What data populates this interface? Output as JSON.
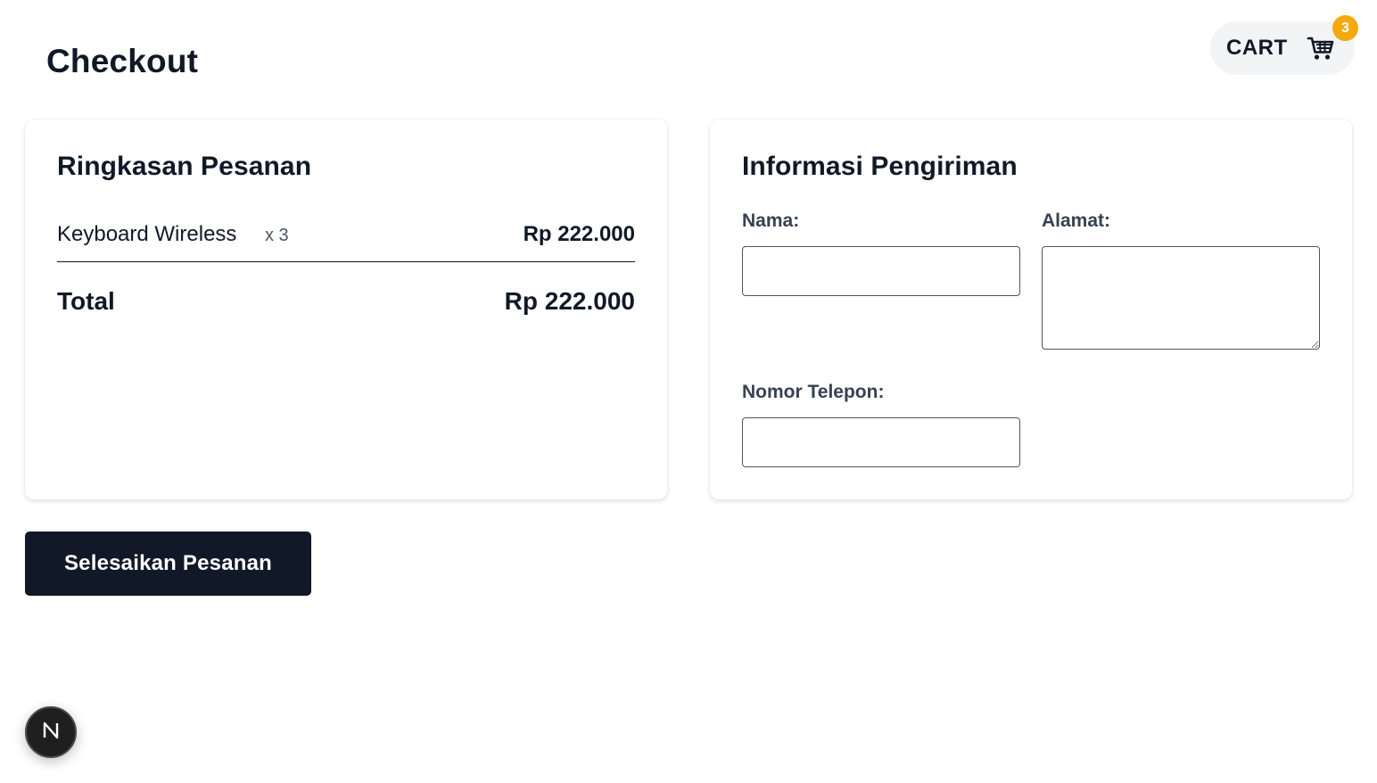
{
  "page": {
    "title": "Checkout"
  },
  "cart": {
    "label": "CART",
    "count": "3",
    "icon": "shopping-cart-icon",
    "badge_color": "#f5a90c"
  },
  "summary": {
    "title": "Ringkasan Pesanan",
    "items": [
      {
        "name": "Keyboard Wireless",
        "qty": "x 3",
        "price": "Rp 222.000"
      }
    ],
    "total_label": "Total",
    "total_value": "Rp 222.000"
  },
  "shipping": {
    "title": "Informasi Pengiriman",
    "name_label": "Nama:",
    "name_value": "",
    "address_label": "Alamat:",
    "address_value": "",
    "phone_label": "Nomor Telepon:",
    "phone_value": ""
  },
  "actions": {
    "submit_label": "Selesaikan Pesanan"
  },
  "dev_indicator": {
    "icon": "nextjs-logo-icon",
    "glyph": "N"
  },
  "colors": {
    "primary": "#111827",
    "accent": "#f5a90c",
    "cart_bg": "#f3f4f6"
  }
}
